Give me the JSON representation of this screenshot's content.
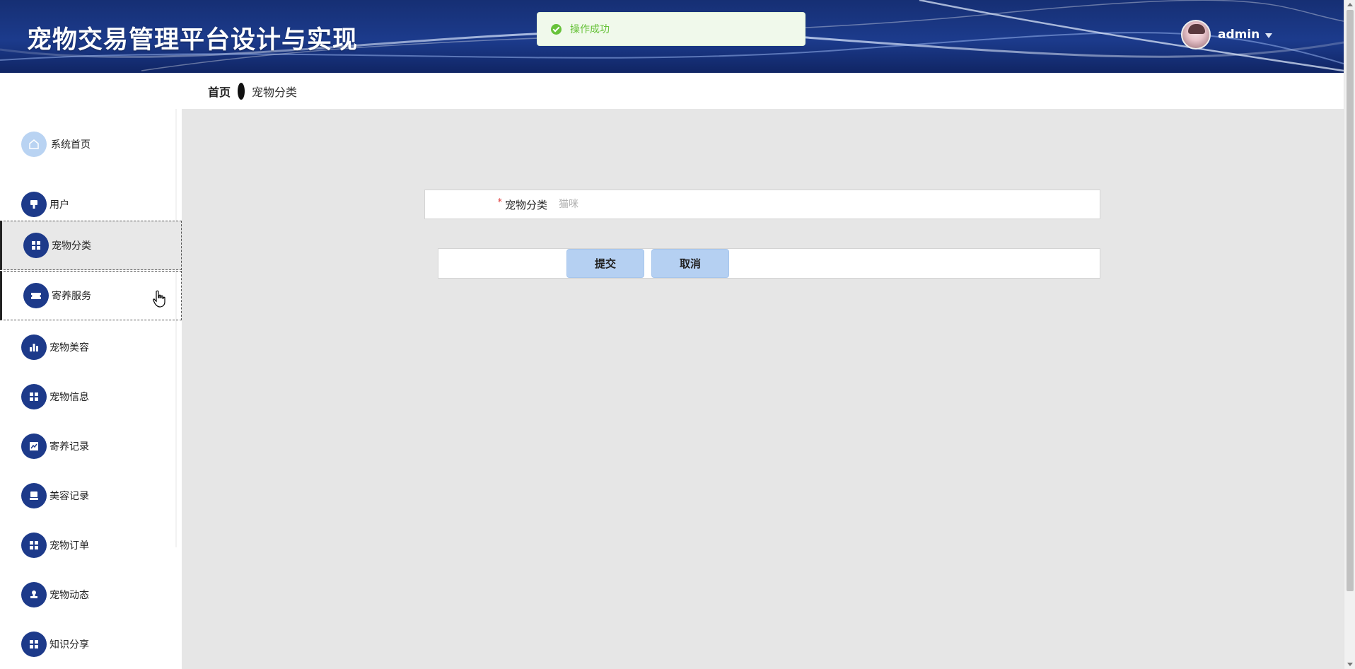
{
  "app": {
    "title": "宠物交易管理平台设计与实现"
  },
  "user": {
    "name": "admin"
  },
  "toast": {
    "message": "操作成功"
  },
  "breadcrumb": {
    "home": "首页",
    "current": "宠物分类"
  },
  "sidebar": {
    "items": [
      {
        "label": "系统首页",
        "icon": "home-icon"
      },
      {
        "label": "用户",
        "icon": "user-badge-icon"
      },
      {
        "label": "宠物分类",
        "icon": "grid-icon"
      },
      {
        "label": "寄养服务",
        "icon": "ticket-icon"
      },
      {
        "label": "宠物美容",
        "icon": "bar-chart-icon"
      },
      {
        "label": "宠物信息",
        "icon": "grid-icon"
      },
      {
        "label": "寄养记录",
        "icon": "line-chart-icon"
      },
      {
        "label": "美容记录",
        "icon": "printer-icon"
      },
      {
        "label": "宠物订单",
        "icon": "grid-icon"
      },
      {
        "label": "宠物动态",
        "icon": "stamp-icon"
      },
      {
        "label": "知识分享",
        "icon": "grid-icon"
      }
    ],
    "active_item": "宠物分类"
  },
  "form": {
    "category_label": "宠物分类",
    "category_placeholder": "猫咪",
    "category_value": "",
    "submit_label": "提交",
    "cancel_label": "取消"
  },
  "colors": {
    "header_bg": "#1c3b8c",
    "nav_icon_bg": "#1d3a8a",
    "button_bg": "#b5d0f2",
    "toast_text": "#67c23a",
    "main_bg": "#e6e6e6"
  }
}
